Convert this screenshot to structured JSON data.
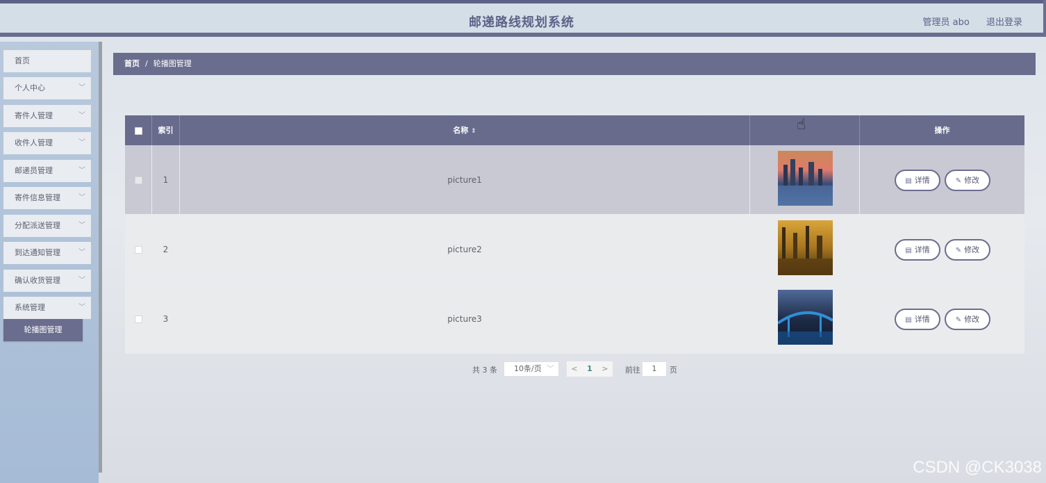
{
  "header": {
    "title": "邮递路线规划系统",
    "user_label": "管理员 abo",
    "logout_label": "退出登录"
  },
  "sidebar": {
    "items": [
      {
        "label": "首页",
        "has_chevron": false
      },
      {
        "label": "个人中心",
        "has_chevron": true
      },
      {
        "label": "寄件人管理",
        "has_chevron": true
      },
      {
        "label": "收件人管理",
        "has_chevron": true
      },
      {
        "label": "邮递员管理",
        "has_chevron": true
      },
      {
        "label": "寄件信息管理",
        "has_chevron": true
      },
      {
        "label": "分配派送管理",
        "has_chevron": true
      },
      {
        "label": "到达通知管理",
        "has_chevron": true
      },
      {
        "label": "确认收货管理",
        "has_chevron": true
      },
      {
        "label": "系统管理",
        "has_chevron": true
      }
    ],
    "active_subitem": "轮播图管理"
  },
  "breadcrumb": {
    "home": "首页",
    "separator": "/",
    "current": "轮播图管理"
  },
  "table": {
    "headers": {
      "index": "索引",
      "name": "名称",
      "actions": "操作"
    },
    "rows": [
      {
        "index": "1",
        "name": "picture1",
        "thumb_colors": [
          "#3a4d7a",
          "#c98a5a",
          "#e07a6a",
          "#5a7fb0"
        ]
      },
      {
        "index": "2",
        "name": "picture2",
        "thumb_colors": [
          "#3a2a12",
          "#a8761e",
          "#d9a53a",
          "#5a3c10"
        ]
      },
      {
        "index": "3",
        "name": "picture3",
        "thumb_colors": [
          "#1d2a44",
          "#4f6a99",
          "#2f8fd8",
          "#0f1a2e"
        ]
      }
    ],
    "detail_label": "详情",
    "edit_label": "修改"
  },
  "pagination": {
    "total_text": "共 3 条",
    "page_size": "10条/页",
    "prev": "<",
    "current_page": "1",
    "next": ">",
    "goto_label": "前往",
    "goto_value": "1",
    "goto_suffix": "页"
  },
  "watermark": "CSDN @CK3038",
  "colors": {
    "primary": "#6a6d8e",
    "header_bg": "#d3dee7",
    "sidebar_bg": "#a6bbd6"
  }
}
